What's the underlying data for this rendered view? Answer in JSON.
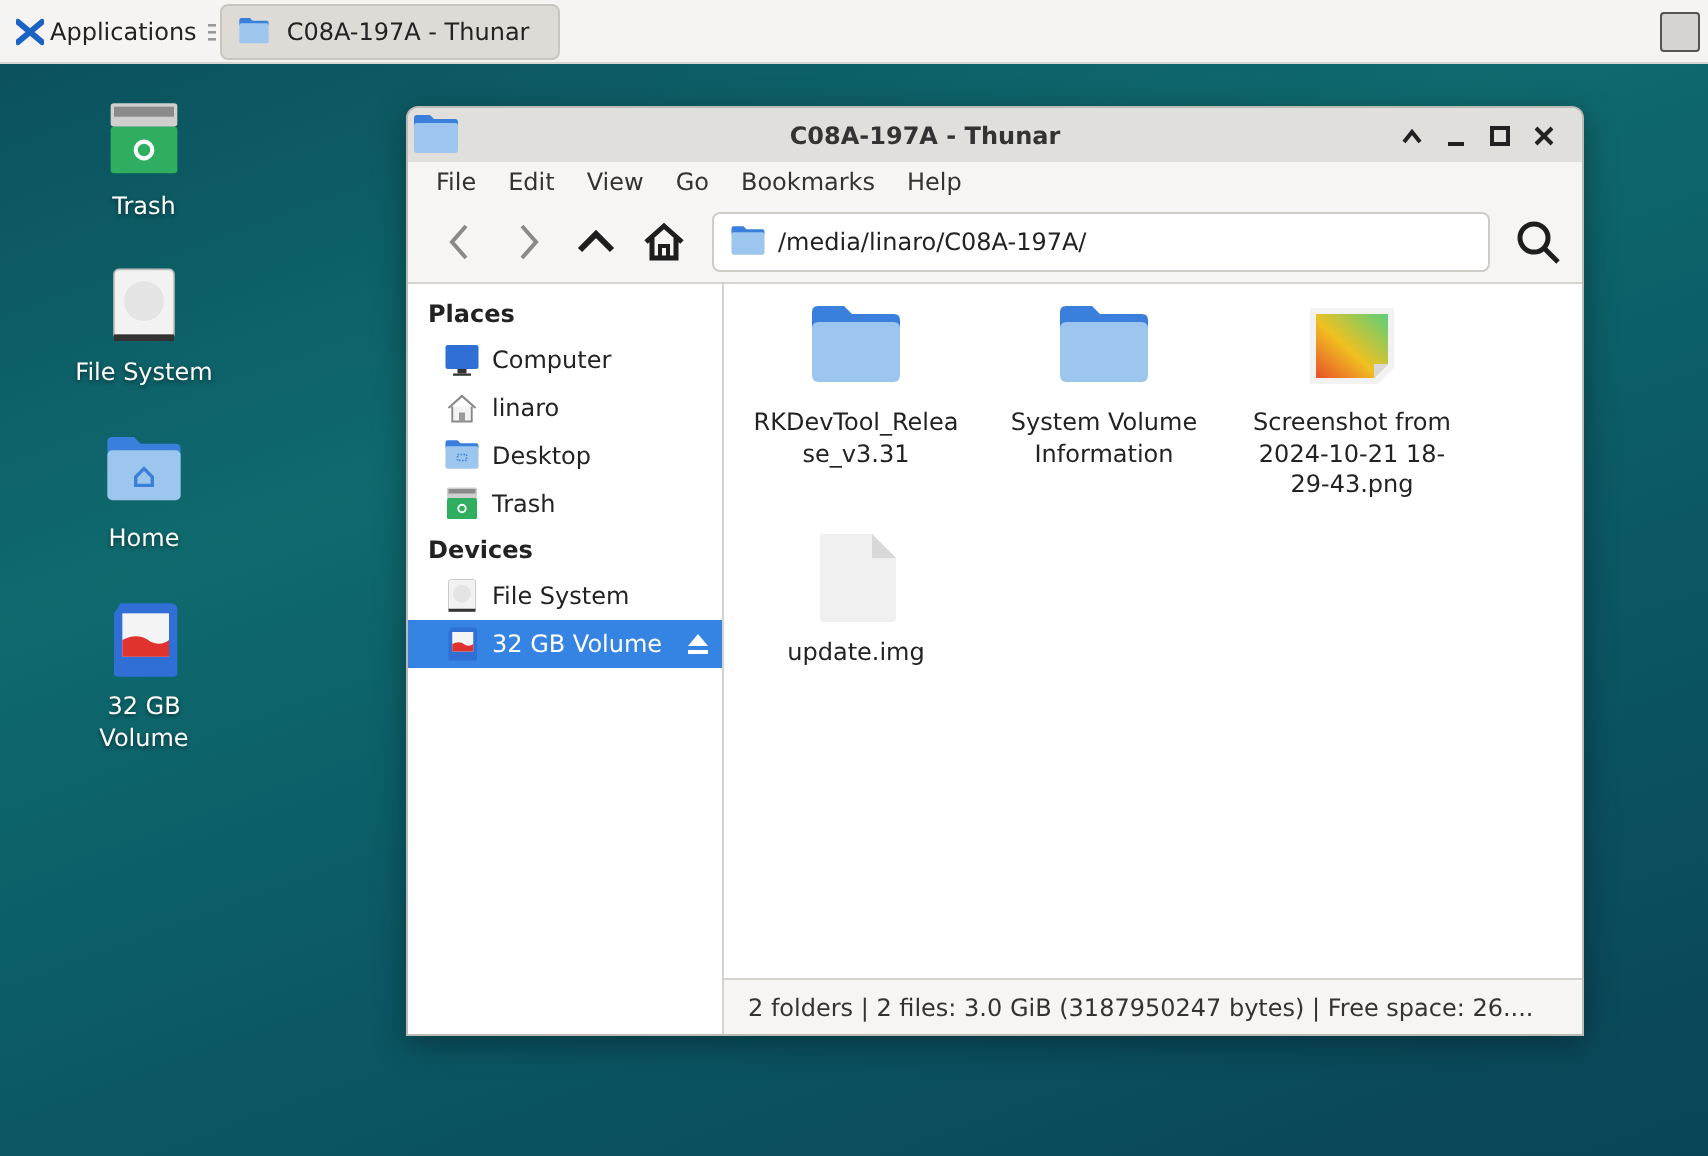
{
  "panel": {
    "menu_label": "Applications",
    "tasks": [
      {
        "label": "C08A-197A - Thunar",
        "selected": true
      }
    ]
  },
  "desktop_icons": [
    {
      "label": "Trash",
      "kind": "trash"
    },
    {
      "label": "File System",
      "kind": "drive"
    },
    {
      "label": "Home",
      "kind": "home"
    },
    {
      "label": "32 GB Volume",
      "kind": "sdcard"
    }
  ],
  "window": {
    "title": "C08A-197A - Thunar",
    "menu": [
      "File",
      "Edit",
      "View",
      "Go",
      "Bookmarks",
      "Help"
    ],
    "toolbar": [
      {
        "kind": "back",
        "disabled": true
      },
      {
        "kind": "forward",
        "disabled": true
      },
      {
        "kind": "up",
        "disabled": false
      },
      {
        "kind": "home",
        "disabled": false
      }
    ],
    "location": "/media/linaro/C08A-197A/",
    "sidebar": [
      {
        "heading": "Places",
        "items": [
          {
            "label": "Computer",
            "kind": "computer",
            "selected": false,
            "ejectable": false
          },
          {
            "label": "linaro",
            "kind": "house",
            "selected": false,
            "ejectable": false
          },
          {
            "label": "Desktop",
            "kind": "desktop",
            "selected": false,
            "ejectable": false
          },
          {
            "label": "Trash",
            "kind": "trash",
            "selected": false,
            "ejectable": false
          }
        ]
      },
      {
        "heading": "Devices",
        "items": [
          {
            "label": "File System",
            "kind": "drive",
            "selected": false,
            "ejectable": false
          },
          {
            "label": "32 GB Volume",
            "kind": "sdcard",
            "selected": true,
            "ejectable": true
          }
        ]
      }
    ],
    "files": [
      {
        "name": "RKDevTool_Release_v3.31",
        "kind": "folder"
      },
      {
        "name": "System Volume Information",
        "kind": "folder"
      },
      {
        "name": "Screenshot from 2024-10-21 18-29-43.png",
        "kind": "image"
      },
      {
        "name": "update.img",
        "kind": "file"
      }
    ],
    "status": "2 folders | 2 files: 3.0 GiB (3187950247 bytes) | Free space: 26...."
  }
}
